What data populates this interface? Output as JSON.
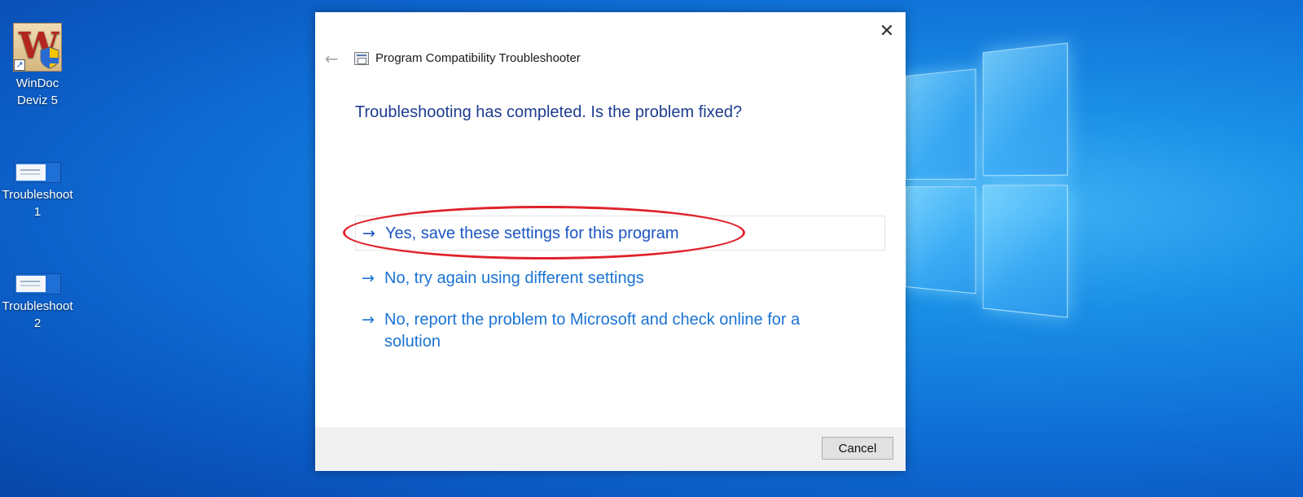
{
  "desktop": {
    "icons": [
      {
        "label_line1": "WinDoc",
        "label_line2": "Deviz 5",
        "icon": "windoc-app-icon"
      },
      {
        "label_line1": "Troubleshoot",
        "label_line2": "1",
        "icon": "troubleshoot-shortcut-icon"
      },
      {
        "label_line1": "Troubleshoot",
        "label_line2": "2",
        "icon": "troubleshoot-shortcut-icon"
      }
    ]
  },
  "dialog": {
    "title": "Program Compatibility Troubleshooter",
    "heading": "Troubleshooting has completed.  Is the problem fixed?",
    "options": [
      {
        "label": "Yes, save these settings for this program"
      },
      {
        "label": "No, try again using different settings"
      },
      {
        "label": "No, report the problem to Microsoft and check online for a solution"
      }
    ],
    "arrow_glyph": "→",
    "back_glyph": "←",
    "close_glyph": "✕",
    "cancel_label": "Cancel"
  },
  "colors": {
    "heading": "#1e3d8f",
    "link": "#1a73d4",
    "highlight_oval": "#e0222b"
  }
}
